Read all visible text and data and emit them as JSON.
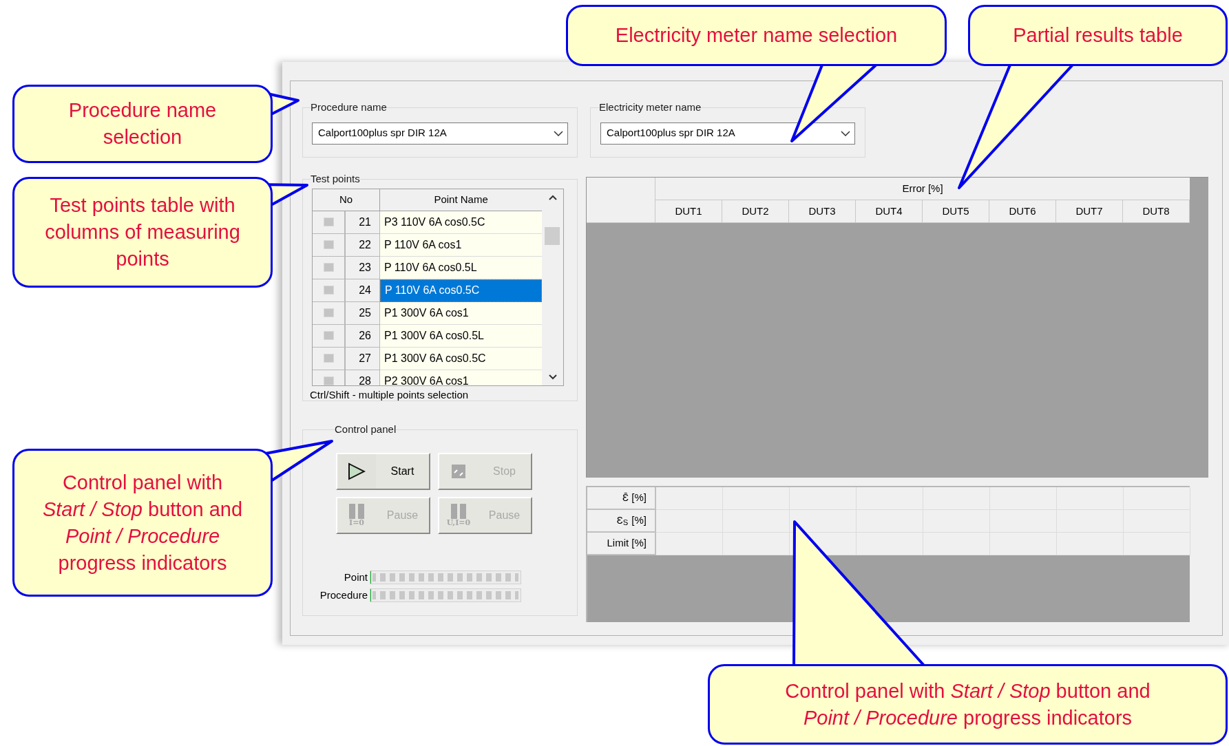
{
  "callouts": [
    {
      "text": "Procedure name\nselection"
    },
    {
      "text": "Test points table with\ncolumns of measuring\npoints"
    },
    {
      "text": "Control panel with\n*Start / Stop* button and\n*Point / Procedure*\nprogress indicators"
    },
    {
      "text": "Electricity meter name selection"
    },
    {
      "text": "Partial results table"
    },
    {
      "text": "Control panel with *Start / Stop* button and\n*Point / Procedure* progress indicators"
    }
  ],
  "procedure": {
    "label": "Procedure name",
    "value": "Calport100plus spr DIR 12A"
  },
  "meter": {
    "label": "Electricity meter name",
    "value": "Calport100plus spr DIR 12A"
  },
  "test_points": {
    "label": "Test points",
    "columns": [
      "No",
      "Point Name"
    ],
    "rows": [
      {
        "no": "21",
        "name": "P3 110V 6A cos0.5C",
        "checked": false,
        "selected": false
      },
      {
        "no": "22",
        "name": "P 110V 6A cos1",
        "checked": false,
        "selected": false
      },
      {
        "no": "23",
        "name": "P 110V 6A cos0.5L",
        "checked": false,
        "selected": false
      },
      {
        "no": "24",
        "name": "P 110V 6A cos0.5C",
        "checked": false,
        "selected": true
      },
      {
        "no": "25",
        "name": "P1 300V 6A cos1",
        "checked": false,
        "selected": false
      },
      {
        "no": "26",
        "name": "P1 300V 6A cos0.5L",
        "checked": false,
        "selected": false
      },
      {
        "no": "27",
        "name": "P1 300V 6A cos0.5C",
        "checked": false,
        "selected": false
      },
      {
        "no": "28",
        "name": "P2 300V 6A cos1",
        "checked": false,
        "selected": false
      }
    ],
    "hint": "Ctrl/Shift - multiple points selection"
  },
  "control_panel": {
    "label": "Control panel",
    "buttons": [
      {
        "kind": "start",
        "label": "Start",
        "disabled": false
      },
      {
        "kind": "stop",
        "label": "Stop",
        "disabled": true
      },
      {
        "kind": "pause",
        "label": "Pause",
        "icon_text": "I=0",
        "disabled": true
      },
      {
        "kind": "pause",
        "label": "Pause",
        "icon_text": "U,I=0",
        "disabled": true
      }
    ],
    "progress": [
      {
        "label": "Point",
        "level": 0
      },
      {
        "label": "Procedure",
        "level": 0
      }
    ]
  },
  "results": {
    "group_header": "Error [%]",
    "columns": [
      "DUT1",
      "DUT2",
      "DUT3",
      "DUT4",
      "DUT5",
      "DUT6",
      "DUT7",
      "DUT8"
    ]
  },
  "summary": {
    "row_labels": [
      "Ɛ̄ [%]",
      "Ɛ$_{S}$ [%]",
      "Limit [%]"
    ]
  }
}
